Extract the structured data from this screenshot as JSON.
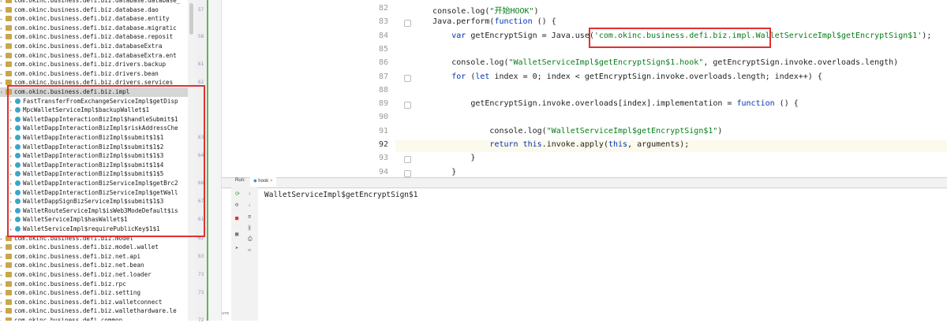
{
  "tree": {
    "items": [
      {
        "label": "com.okinc.business.defi.biz.database.database_",
        "kind": "pkg"
      },
      {
        "label": "com.okinc.business.defi.biz.database.dao",
        "kind": "pkg"
      },
      {
        "label": "com.okinc.business.defi.biz.database.entity",
        "kind": "pkg"
      },
      {
        "label": "com.okinc.business.defi.biz.database.migratic",
        "kind": "pkg"
      },
      {
        "label": "com.okinc.business.defi.biz.database.reposit",
        "kind": "pkg"
      },
      {
        "label": "com.okinc.business.defi.biz.databaseExtra",
        "kind": "pkg"
      },
      {
        "label": "com.okinc.business.defi.biz.databaseExtra.ent",
        "kind": "pkg"
      },
      {
        "label": "com.okinc.business.defi.biz.drivers.backup",
        "kind": "pkg"
      },
      {
        "label": "com.okinc.business.defi.biz.drivers.bean",
        "kind": "pkg"
      },
      {
        "label": "com.okinc.business.defi.biz.drivers.services",
        "kind": "pkg"
      },
      {
        "label": "com.okinc.business.defi.biz.impl",
        "kind": "pkg-open"
      },
      {
        "label": "FastTransferFromExchangeServiceImpl$getDisp",
        "kind": "cls"
      },
      {
        "label": "MpcWalletServiceImpl$backupWallet$1",
        "kind": "cls"
      },
      {
        "label": "WalletDappInteractionBizImpl$handleSubmit$1",
        "kind": "cls"
      },
      {
        "label": "WalletDappInteractionBizImpl$riskAddressChe",
        "kind": "cls"
      },
      {
        "label": "WalletDappInteractionBizImpl$submit$1$1",
        "kind": "cls"
      },
      {
        "label": "WalletDappInteractionBizImpl$submit$1$2",
        "kind": "cls"
      },
      {
        "label": "WalletDappInteractionBizImpl$submit$1$3",
        "kind": "cls"
      },
      {
        "label": "WalletDappInteractionBizImpl$submit$1$4",
        "kind": "cls"
      },
      {
        "label": "WalletDappInteractionBizImpl$submit$1$5",
        "kind": "cls"
      },
      {
        "label": "WalletDappInteractionBizServiceImpl$getBrc2",
        "kind": "cls"
      },
      {
        "label": "WalletDappInteractionBizServiceImpl$getWall",
        "kind": "cls"
      },
      {
        "label": "WalletDappSignBizServiceImpl$submit$1$3",
        "kind": "cls"
      },
      {
        "label": "WalletRouteServiceImpl$isWeb3ModeDefault$is",
        "kind": "cls"
      },
      {
        "label": "WalletServiceImpl$hasWallet$1",
        "kind": "cls"
      },
      {
        "label": "WalletServiceImpl$requirePublicKey$1$1",
        "kind": "cls"
      },
      {
        "label": "com.okinc.business.defi.biz.model",
        "kind": "pkg"
      },
      {
        "label": "com.okinc.business.defi.biz.model.wallet",
        "kind": "pkg"
      },
      {
        "label": "com.okinc.business.defi.biz.net.api",
        "kind": "pkg"
      },
      {
        "label": "com.okinc.business.defi.biz.net.bean",
        "kind": "pkg"
      },
      {
        "label": "com.okinc.business.defi.biz.net.loader",
        "kind": "pkg"
      },
      {
        "label": "com.okinc.business.defi.biz.rpc",
        "kind": "pkg"
      },
      {
        "label": "com.okinc.business.defi.biz.setting",
        "kind": "pkg"
      },
      {
        "label": "com.okinc.business.defi.biz.walletconnect",
        "kind": "pkg"
      },
      {
        "label": "com.okinc.business.defi.biz.wallethardware.le",
        "kind": "pkg"
      },
      {
        "label": "com.okinc.business.defi.common",
        "kind": "pkg"
      }
    ]
  },
  "side_numbers": [
    {
      "text": "57",
      "row": 1
    },
    {
      "text": "58",
      "row": 4
    },
    {
      "text": "61",
      "row": 7
    },
    {
      "text": "62",
      "row": 9
    },
    {
      "text": "63",
      "row": 15
    },
    {
      "text": "64",
      "row": 17
    },
    {
      "text": "66",
      "row": 20
    },
    {
      "text": "67",
      "row": 22
    },
    {
      "text": "61",
      "row": 24
    },
    {
      "text": "62",
      "row": 26
    },
    {
      "text": "63",
      "row": 28
    },
    {
      "text": "73",
      "row": 30
    },
    {
      "text": "73",
      "row": 32
    },
    {
      "text": "72",
      "row": 35
    }
  ],
  "editor": {
    "lines": [
      {
        "num": "82",
        "segments": [
          {
            "t": "        console.log(",
            "c": ""
          },
          {
            "t": "\"开始HOOK\"",
            "c": "str"
          },
          {
            "t": ")",
            "c": ""
          }
        ]
      },
      {
        "num": "83",
        "segments": [
          {
            "t": "        Java.perform(",
            "c": ""
          },
          {
            "t": "function",
            "c": "kw"
          },
          {
            "t": " () {",
            "c": ""
          }
        ]
      },
      {
        "num": "84",
        "segments": [
          {
            "t": "            ",
            "c": ""
          },
          {
            "t": "var",
            "c": "kw"
          },
          {
            "t": " getEncryptSign = Java.use(",
            "c": ""
          },
          {
            "t": "'com.okinc.business.defi.biz.impl.WalletServiceImpl$getEncryptSign$1'",
            "c": "str"
          },
          {
            "t": ");",
            "c": ""
          }
        ]
      },
      {
        "num": "85",
        "segments": []
      },
      {
        "num": "86",
        "segments": [
          {
            "t": "            console.log(",
            "c": ""
          },
          {
            "t": "\"WalletServiceImpl$getEncryptSign$1.hook\"",
            "c": "str"
          },
          {
            "t": ", getEncryptSign.invoke.overloads.length)",
            "c": ""
          }
        ]
      },
      {
        "num": "87",
        "segments": [
          {
            "t": "            ",
            "c": ""
          },
          {
            "t": "for",
            "c": "kw"
          },
          {
            "t": " (",
            "c": ""
          },
          {
            "t": "let",
            "c": "kw"
          },
          {
            "t": " index = 0; index < getEncryptSign.invoke.overloads.length; index++) {",
            "c": ""
          }
        ]
      },
      {
        "num": "88",
        "segments": []
      },
      {
        "num": "89",
        "segments": [
          {
            "t": "                getEncryptSign.invoke.overloads[index].implementation = ",
            "c": ""
          },
          {
            "t": "function",
            "c": "kw"
          },
          {
            "t": " () {",
            "c": ""
          }
        ]
      },
      {
        "num": "90",
        "segments": []
      },
      {
        "num": "91",
        "segments": [
          {
            "t": "                    console.log(",
            "c": ""
          },
          {
            "t": "\"WalletServiceImpl$getEncryptSign$1\"",
            "c": "str"
          },
          {
            "t": ")",
            "c": ""
          }
        ]
      },
      {
        "num": "92",
        "segments": [
          {
            "t": "                    ",
            "c": ""
          },
          {
            "t": "return",
            "c": "kw"
          },
          {
            "t": " ",
            "c": ""
          },
          {
            "t": "this",
            "c": "kw"
          },
          {
            "t": ".invoke.apply(",
            "c": ""
          },
          {
            "t": "this",
            "c": "kw"
          },
          {
            "t": ", arguments);",
            "c": ""
          }
        ]
      },
      {
        "num": "93",
        "segments": [
          {
            "t": "                }",
            "c": ""
          }
        ]
      },
      {
        "num": "94",
        "segments": [
          {
            "t": "            }",
            "c": ""
          }
        ]
      }
    ]
  },
  "run": {
    "label": "Run:",
    "tab": "hook",
    "output": "WalletServiceImpl$getEncryptSign$1",
    "vertical_label": "ure"
  }
}
